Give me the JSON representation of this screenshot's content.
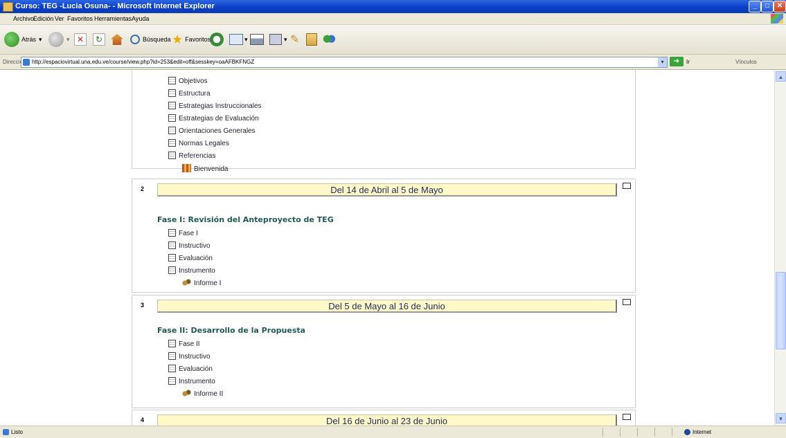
{
  "window": {
    "title": "Curso: TEG -Lucia Osuna- - Microsoft Internet Explorer",
    "minimize": "_",
    "maximize": "□",
    "close": "✕"
  },
  "menu": [
    "Archivo",
    "Edición",
    "Ver",
    "Favoritos",
    "Herramientas",
    "Ayuda"
  ],
  "toolbar": {
    "back_label": "Atrás",
    "search_label": "Búsqueda",
    "favorites_label": "Favoritos"
  },
  "address": {
    "label": "Dirección",
    "url": "http://espaciovirtual.una.edu.ve/course/view.php?id=253&edit=off&sesskey=oaAFBKFNGZ",
    "go_label": "Ir",
    "links_label": "Vínculos"
  },
  "course": {
    "section1_items": [
      {
        "icon": "document-icon",
        "label": "Objetivos"
      },
      {
        "icon": "document-icon",
        "label": "Estructura"
      },
      {
        "icon": "document-icon",
        "label": "Estrategias Instruccionales"
      },
      {
        "icon": "document-icon",
        "label": "Estrategias de Evaluación"
      },
      {
        "icon": "document-icon",
        "label": "Orientaciones Generales"
      },
      {
        "icon": "document-icon",
        "label": "Normas Legales"
      },
      {
        "icon": "document-icon",
        "label": "Referencias"
      },
      {
        "icon": "resource-icon",
        "label": "Bienvenida"
      }
    ],
    "sections": [
      {
        "number": "2",
        "title": "Del 14  de Abril al 5 de Mayo",
        "phase": "Fase I: Revisión del Anteproyecto de TEG",
        "items": [
          {
            "icon": "document-icon",
            "label": "Fase I"
          },
          {
            "icon": "document-icon",
            "label": "Instructivo"
          },
          {
            "icon": "document-icon",
            "label": "Evaluación"
          },
          {
            "icon": "document-icon",
            "label": "Instrumento"
          },
          {
            "icon": "forum-icon",
            "label": "Informe I"
          }
        ]
      },
      {
        "number": "3",
        "title": "Del 5 de Mayo al 16 de Junio",
        "phase": "Fase II: Desarrollo de la Propuesta",
        "items": [
          {
            "icon": "document-icon",
            "label": "Fase II"
          },
          {
            "icon": "document-icon",
            "label": "Instructivo"
          },
          {
            "icon": "document-icon",
            "label": "Evaluación"
          },
          {
            "icon": "document-icon",
            "label": "Instrumento"
          },
          {
            "icon": "forum-icon",
            "label": "Informe II"
          }
        ]
      },
      {
        "number": "4",
        "title": "Del 16 de Junio al 23 de Junio"
      }
    ]
  },
  "status": {
    "text": "Listo",
    "zone": "Internet"
  },
  "colors": {
    "banner_bg": "#fff8c8",
    "phase_text": "#1f5b56",
    "title_bar": "#0a3fc7"
  }
}
